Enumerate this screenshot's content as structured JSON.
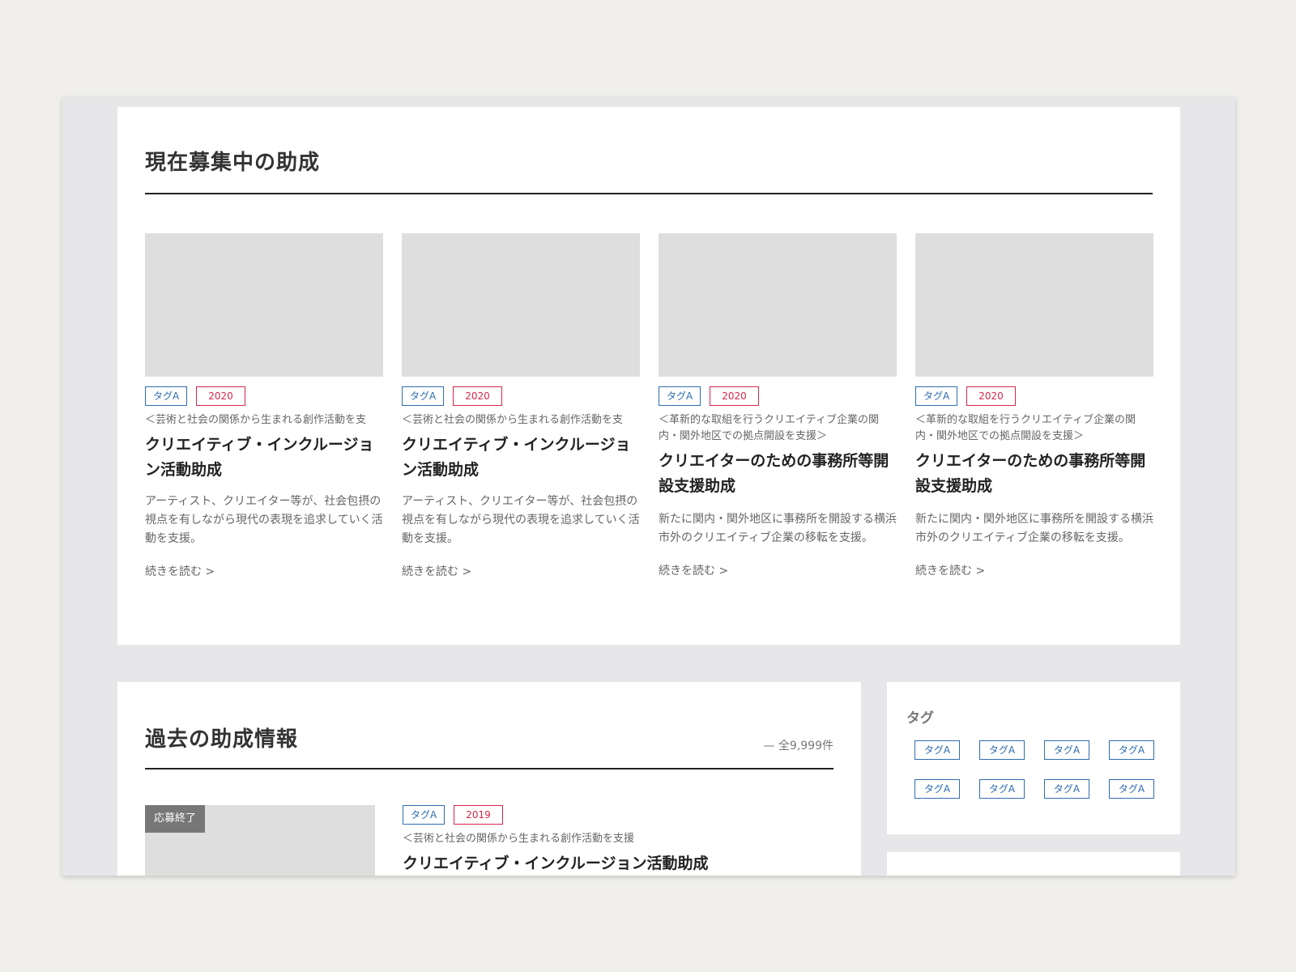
{
  "current": {
    "title": "現在募集中の助成",
    "cards": [
      {
        "tag": "タグA",
        "year": "2020",
        "subtitle": "＜芸術と社会の関係から生まれる創作活動を支",
        "title": "クリエイティブ・インクルージョン活動助成",
        "desc": "アーティスト、クリエイター等が、社会包摂の視点を有しながら現代の表現を追求していく活動を支援。",
        "more": "続きを読む >"
      },
      {
        "tag": "タグA",
        "year": "2020",
        "subtitle": "＜芸術と社会の関係から生まれる創作活動を支",
        "title": "クリエイティブ・インクルージョン活動助成",
        "desc": "アーティスト、クリエイター等が、社会包摂の視点を有しながら現代の表現を追求していく活動を支援。",
        "more": "続きを読む >"
      },
      {
        "tag": "タグA",
        "year": "2020",
        "subtitle": "＜革新的な取組を行うクリエイティブ企業の関内・関外地区での拠点開設を支援＞",
        "title": "クリエイターのための事務所等開設支援助成",
        "desc": "新たに関内・関外地区に事務所を開設する横浜市外のクリエイティブ企業の移転を支援。",
        "more": "続きを読む >"
      },
      {
        "tag": "タグA",
        "year": "2020",
        "subtitle": "＜革新的な取組を行うクリエイティブ企業の関内・関外地区での拠点開設を支援＞",
        "title": "クリエイターのための事務所等開設支援助成",
        "desc": "新たに関内・関外地区に事務所を開設する横浜市外のクリエイティブ企業の移転を支援。",
        "more": "続きを読む >"
      }
    ]
  },
  "past": {
    "title": "過去の助成情報",
    "count": "— 全9,999件",
    "item": {
      "badge": "応募終了",
      "tag": "タグA",
      "year": "2019",
      "subtitle": "＜芸術と社会の関係から生まれる創作活動を支援",
      "title": "クリエイティブ・インクルージョン活動助成"
    }
  },
  "sidebar": {
    "tags_title": "タグ",
    "tags": [
      "タグA",
      "タグA",
      "タグA",
      "タグA",
      "タグA",
      "タグA",
      "タグA",
      "タグA"
    ]
  },
  "colors": {
    "tag_blue": "#2f6db0",
    "year_red": "#d8264a",
    "placeholder": "#dedede",
    "frame_bg": "#e7e7ea"
  }
}
